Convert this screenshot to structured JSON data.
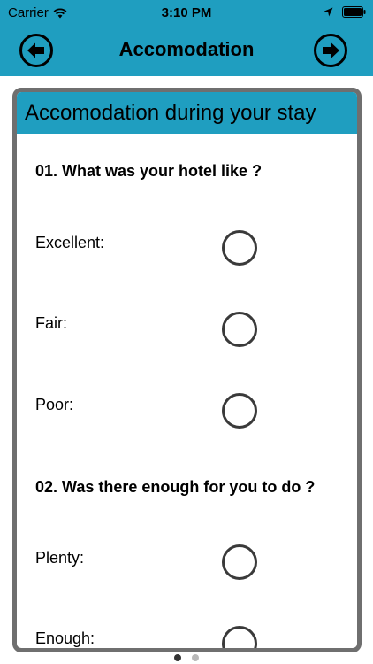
{
  "status_bar": {
    "carrier": "Carrier",
    "time": "3:10 PM",
    "icons": [
      "wifi-icon",
      "location-arrow-icon",
      "battery-icon"
    ]
  },
  "nav": {
    "title": "Accomodation",
    "back_icon": "arrow-left-circle-icon",
    "next_icon": "arrow-right-circle-icon"
  },
  "card": {
    "header": "Accomodation during your stay",
    "questions": [
      {
        "text": "01. What was your hotel like ?",
        "options": [
          "Excellent:",
          "Fair:",
          "Poor:"
        ]
      },
      {
        "text": "02. Was there enough for you to do ?",
        "options": [
          "Plenty:",
          "Enough:"
        ]
      }
    ]
  },
  "pagination": {
    "pages": 2,
    "current": 1
  },
  "colors": {
    "accent": "#1f9ec0",
    "card_border": "#6f6f6f",
    "radio_border": "#3a3a3a"
  }
}
